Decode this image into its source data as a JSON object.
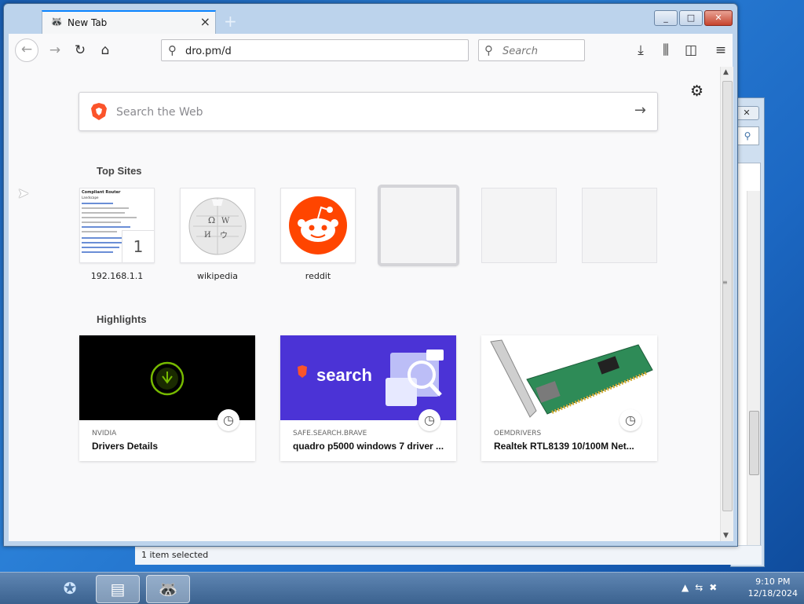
{
  "background_window": {
    "close_label": "x",
    "status": "1 item selected"
  },
  "tab": {
    "title": "New Tab",
    "close": "×",
    "new_tab": "+"
  },
  "window_buttons": {
    "minimize": "_",
    "maximize": "□",
    "close": "✕"
  },
  "toolbar": {
    "url": "dro.pm/d",
    "search_placeholder": "Search",
    "icons": [
      "back-icon",
      "forward-icon",
      "reload-icon",
      "home-icon",
      "download-icon",
      "library-icon",
      "sidebar-icon",
      "menu-icon"
    ]
  },
  "newtab": {
    "web_search_placeholder": "Search the Web",
    "top_sites_title": "Top Sites",
    "highlights_title": "Highlights",
    "top_sites": [
      {
        "label": "192.168.1.1",
        "pin": "1"
      },
      {
        "label": "wikipedia"
      },
      {
        "label": "reddit"
      },
      {
        "label": ""
      },
      {
        "label": ""
      },
      {
        "label": ""
      }
    ],
    "highlights": [
      {
        "source": "NVIDIA",
        "title": "Drivers Details"
      },
      {
        "source": "SAFE.SEARCH.BRAVE",
        "title": "quadro p5000 windows 7 driver ...",
        "banner": "search"
      },
      {
        "source": "OEMDRIVERS",
        "title": "Realtek RTL8139 10/100M Net..."
      }
    ],
    "thumbnail_doc": {
      "title": "Compliant Router",
      "subtitle": "Landscape"
    }
  },
  "taskbar": {
    "time": "9:10 PM",
    "date": "12/18/2024"
  },
  "colors": {
    "accent": "#0a84ff",
    "brave_orange": "#fb542b",
    "reddit": "#ff4500",
    "nvidia_green": "#76b900",
    "brave_search_bg": "#4b33d6"
  }
}
